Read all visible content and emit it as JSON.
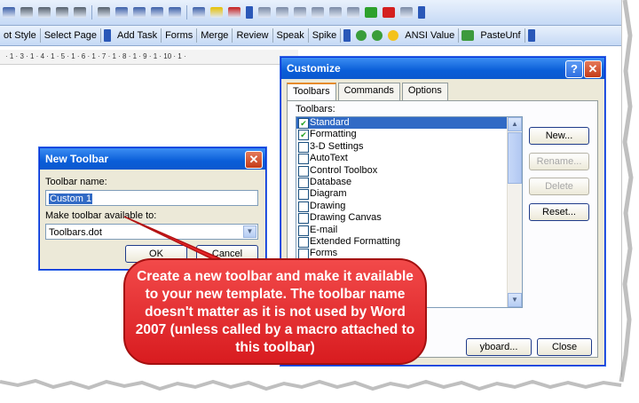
{
  "toolbar_formatting": {
    "icons": [
      "bold-paint-icon",
      "align-left-icon",
      "align-center-icon",
      "align-right-icon",
      "justify-icon",
      "line-spacing-icon",
      "numbering-icon",
      "bullets-icon",
      "decrease-indent-icon",
      "increase-indent-icon",
      "border-icon",
      "highlight-icon",
      "font-color-icon"
    ]
  },
  "toolbar_custom": {
    "buttons": [
      "ot Style",
      "Select Page",
      "Add Task",
      "Forms",
      "Merge",
      "Review",
      "Speak",
      "Spike",
      "ANSI Value",
      "PasteUnf"
    ]
  },
  "ruler": {
    "text": "· 1 · 3 · 1 · 4 · 1 · 5 · 1 · 6 · 1 · 7 · 1 · 8 · 1 · 9 · 1 · 10 · 1 ·"
  },
  "customize": {
    "title": "Customize",
    "help_glyph": "?",
    "close_glyph": "✕",
    "tabs": [
      "Toolbars",
      "Commands",
      "Options"
    ],
    "toolbars_label": "Toolbars:",
    "items": [
      {
        "label": "Standard",
        "checked": true,
        "selected": true
      },
      {
        "label": "Formatting",
        "checked": true,
        "selected": false
      },
      {
        "label": "3-D Settings",
        "checked": false,
        "selected": false
      },
      {
        "label": "AutoText",
        "checked": false,
        "selected": false
      },
      {
        "label": "Control Toolbox",
        "checked": false,
        "selected": false
      },
      {
        "label": "Database",
        "checked": false,
        "selected": false
      },
      {
        "label": "Diagram",
        "checked": false,
        "selected": false
      },
      {
        "label": "Drawing",
        "checked": false,
        "selected": false
      },
      {
        "label": "Drawing Canvas",
        "checked": false,
        "selected": false
      },
      {
        "label": "E-mail",
        "checked": false,
        "selected": false
      },
      {
        "label": "Extended Formatting",
        "checked": false,
        "selected": false
      },
      {
        "label": "Forms",
        "checked": false,
        "selected": false
      }
    ],
    "new_button": "New...",
    "rename_button": "Rename...",
    "delete_button": "Delete",
    "reset_button": "Reset...",
    "keyboard_button": "yboard...",
    "close_button": "Close"
  },
  "new_toolbar": {
    "title": "New Toolbar",
    "close_glyph": "✕",
    "name_label": "Toolbar name:",
    "name_value": "Custom 1",
    "available_label": "Make toolbar available to:",
    "available_value": "Toolbars.dot",
    "ok_button": "OK",
    "cancel_button": "Cancel"
  },
  "callout": {
    "text": "Create a new toolbar and make it available to your new template. The toolbar name doesn't matter as it is not used by Word 2007 (unless called by a macro attached to this toolbar)"
  },
  "colors": {
    "callout_fill": "#e8262a",
    "title_blue": "#0a5ed8",
    "selection": "#316ac5"
  }
}
